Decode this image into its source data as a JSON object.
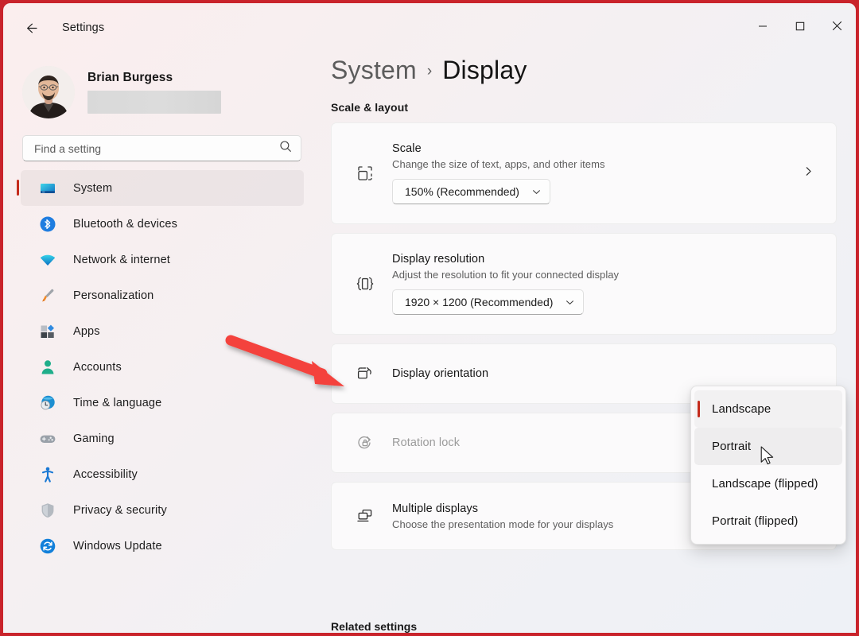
{
  "window": {
    "title": "Settings",
    "back_icon": "back-arrow-icon",
    "minimize_label": "Minimize",
    "maximize_label": "Maximize",
    "close_label": "Close"
  },
  "sidebar": {
    "profile": {
      "name": "Brian Burgess",
      "email_redacted": true
    },
    "search": {
      "placeholder": "Find a setting",
      "value": "",
      "icon": "search-icon"
    },
    "items": [
      {
        "label": "System",
        "icon": "monitor-icon",
        "selected": true
      },
      {
        "label": "Bluetooth & devices",
        "icon": "bluetooth-icon",
        "selected": false
      },
      {
        "label": "Network & internet",
        "icon": "wifi-icon",
        "selected": false
      },
      {
        "label": "Personalization",
        "icon": "paintbrush-icon",
        "selected": false
      },
      {
        "label": "Apps",
        "icon": "apps-icon",
        "selected": false
      },
      {
        "label": "Accounts",
        "icon": "person-icon",
        "selected": false
      },
      {
        "label": "Time & language",
        "icon": "clock-globe-icon",
        "selected": false
      },
      {
        "label": "Gaming",
        "icon": "gamepad-icon",
        "selected": false
      },
      {
        "label": "Accessibility",
        "icon": "accessibility-icon",
        "selected": false
      },
      {
        "label": "Privacy & security",
        "icon": "shield-icon",
        "selected": false
      },
      {
        "label": "Windows Update",
        "icon": "update-icon",
        "selected": false
      }
    ]
  },
  "main": {
    "breadcrumb": {
      "parent": "System",
      "separator": "›",
      "current": "Display"
    },
    "section_title": "Scale & layout",
    "footer_section_title": "Related settings",
    "cards": [
      {
        "title": "Scale",
        "subtitle": "Change the size of text, apps, and other items",
        "icon": "scale-icon",
        "combo_value": "150% (Recommended)",
        "trailing_icon": "chevron-right-icon",
        "disabled": false
      },
      {
        "title": "Display resolution",
        "subtitle": "Adjust the resolution to fit your connected display",
        "icon": "resolution-icon",
        "combo_value": "1920 × 1200 (Recommended)",
        "trailing_icon": "",
        "disabled": false
      },
      {
        "title": "Display orientation",
        "subtitle": "",
        "icon": "display-rotate-icon",
        "combo_value": "",
        "trailing_icon": "",
        "disabled": false
      },
      {
        "title": "Rotation lock",
        "subtitle": "",
        "icon": "rotation-lock-icon",
        "combo_value": "",
        "trailing_icon": "",
        "disabled": true
      },
      {
        "title": "Multiple displays",
        "subtitle": "Choose the presentation mode for your displays",
        "icon": "multiple-displays-icon",
        "trailing_icon": "chevron-down-icon",
        "combo_value": "",
        "disabled": false
      }
    ]
  },
  "orientation_flyout": {
    "options": [
      {
        "label": "Landscape",
        "checked": true,
        "hovered": false
      },
      {
        "label": "Portrait",
        "checked": false,
        "hovered": true
      },
      {
        "label": "Landscape (flipped)",
        "checked": false,
        "hovered": false
      },
      {
        "label": "Portrait (flipped)",
        "checked": false,
        "hovered": false
      }
    ]
  },
  "annotation": {
    "arrow_color": "#f4433c",
    "type": "arrow"
  },
  "colors": {
    "accent_selection": "#c42b1c",
    "window_border": "#c9232b",
    "card_background": "#fbfafb",
    "page_background": "#f1f1f5"
  }
}
